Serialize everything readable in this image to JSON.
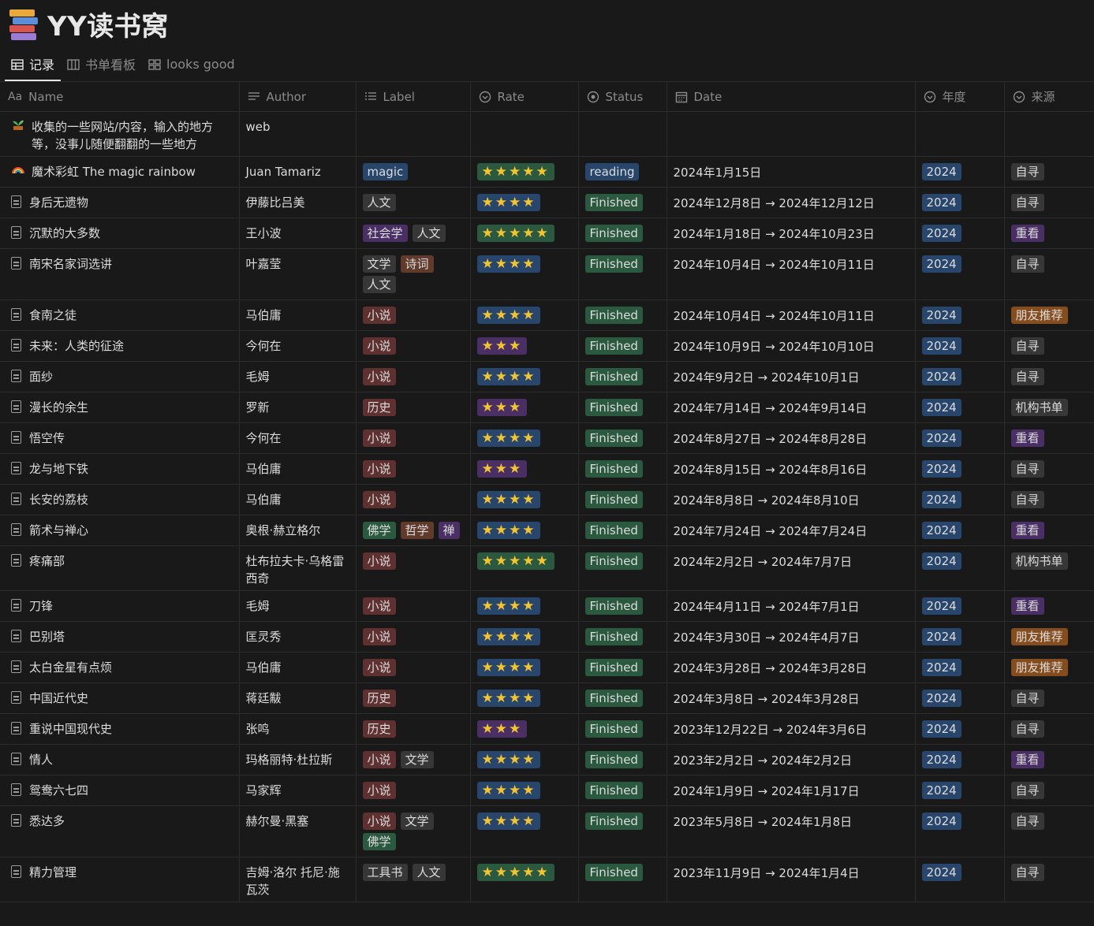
{
  "page": {
    "title": "YY读书窝",
    "tabs": [
      {
        "label": "记录",
        "icon": "table-icon",
        "active": true
      },
      {
        "label": "书单看板",
        "icon": "board-icon",
        "active": false
      },
      {
        "label": "looks good",
        "icon": "gallery-icon",
        "active": false
      }
    ]
  },
  "columns": [
    {
      "label": "Name",
      "prefix": "Aa",
      "icon": "title-icon"
    },
    {
      "label": "Author",
      "icon": "text-icon"
    },
    {
      "label": "Label",
      "icon": "multiselect-icon"
    },
    {
      "label": "Rate",
      "icon": "select-icon"
    },
    {
      "label": "Status",
      "icon": "status-icon"
    },
    {
      "label": "Date",
      "icon": "calendar-icon"
    },
    {
      "label": "年度",
      "icon": "select-icon"
    },
    {
      "label": "来源",
      "icon": "select-icon"
    }
  ],
  "colors": {
    "tag_default": "#373737",
    "tag_purple": "#492f64",
    "tag_red": "#5e3030",
    "tag_brown": "#603b2c",
    "tag_green": "#2b593f",
    "tag_blue": "#28456c",
    "tag_orange": "#854c1d",
    "stars_green": "#2b593f",
    "stars_blue": "#28456c",
    "stars_purple": "#492f64",
    "star": "#f4c430"
  },
  "rows": [
    {
      "icon": "plant-icon",
      "name": "收集的一些网站/内容，输入的地方等，没事儿随便翻翻的一些地方",
      "author": "web",
      "labels": [],
      "rate": "",
      "status": "",
      "date": "",
      "year": "",
      "source": ""
    },
    {
      "icon": "rainbow-icon",
      "name": "魔术彩虹 The magic rainbow",
      "author": "Juan Tamariz",
      "labels": [
        {
          "t": "magic",
          "c": "tag_blue"
        }
      ],
      "rate": "★★★★★",
      "rate_color": "stars_green",
      "status": "reading",
      "status_color": "tag_blue",
      "date": "2024年1月15日",
      "year": "2024",
      "source": "自寻",
      "source_color": "tag_default"
    },
    {
      "icon": "doc-icon",
      "name": "身后无遗物",
      "author": "伊藤比吕美",
      "labels": [
        {
          "t": "人文",
          "c": "tag_default"
        }
      ],
      "rate": "★★★★",
      "rate_color": "stars_blue",
      "status": "Finished",
      "status_color": "tag_green",
      "date": "2024年12月8日 → 2024年12月12日",
      "year": "2024",
      "source": "自寻",
      "source_color": "tag_default"
    },
    {
      "icon": "doc-icon",
      "name": "沉默的大多数",
      "author": "王小波",
      "labels": [
        {
          "t": "社会学",
          "c": "tag_purple"
        },
        {
          "t": "人文",
          "c": "tag_default"
        }
      ],
      "rate": "★★★★★",
      "rate_color": "stars_green",
      "status": "Finished",
      "status_color": "tag_green",
      "date": "2024年1月18日 → 2024年10月23日",
      "year": "2024",
      "source": "重看",
      "source_color": "tag_purple"
    },
    {
      "icon": "doc-icon",
      "name": "南宋名家词选讲",
      "author": "叶嘉莹",
      "labels": [
        {
          "t": "文学",
          "c": "tag_default"
        },
        {
          "t": "诗词",
          "c": "tag_brown"
        },
        {
          "t": "人文",
          "c": "tag_default"
        }
      ],
      "rate": "★★★★",
      "rate_color": "stars_blue",
      "status": "Finished",
      "status_color": "tag_green",
      "date": "2024年10月4日 → 2024年10月11日",
      "year": "2024",
      "source": "自寻",
      "source_color": "tag_default"
    },
    {
      "icon": "doc-icon",
      "name": "食南之徒",
      "author": "马伯庸",
      "labels": [
        {
          "t": "小说",
          "c": "tag_red"
        }
      ],
      "rate": "★★★★",
      "rate_color": "stars_blue",
      "status": "Finished",
      "status_color": "tag_green",
      "date": "2024年10月4日 → 2024年10月11日",
      "year": "2024",
      "source": "朋友推荐",
      "source_color": "tag_orange"
    },
    {
      "icon": "doc-icon",
      "name": "未来：人类的征途",
      "author": "今何在",
      "labels": [
        {
          "t": "小说",
          "c": "tag_red"
        }
      ],
      "rate": "★★★",
      "rate_color": "stars_purple",
      "status": "Finished",
      "status_color": "tag_green",
      "date": "2024年10月9日 → 2024年10月10日",
      "year": "2024",
      "source": "自寻",
      "source_color": "tag_default"
    },
    {
      "icon": "doc-icon",
      "name": "面纱",
      "author": "毛姆",
      "labels": [
        {
          "t": "小说",
          "c": "tag_red"
        }
      ],
      "rate": "★★★★",
      "rate_color": "stars_blue",
      "status": "Finished",
      "status_color": "tag_green",
      "date": "2024年9月2日 → 2024年10月1日",
      "year": "2024",
      "source": "自寻",
      "source_color": "tag_default"
    },
    {
      "icon": "doc-icon",
      "name": "漫长的余生",
      "author": "罗新",
      "labels": [
        {
          "t": "历史",
          "c": "tag_red"
        }
      ],
      "rate": "★★★",
      "rate_color": "stars_purple",
      "status": "Finished",
      "status_color": "tag_green",
      "date": "2024年7月14日 → 2024年9月14日",
      "year": "2024",
      "source": "机构书单",
      "source_color": "tag_default"
    },
    {
      "icon": "doc-icon",
      "name": "悟空传",
      "author": "今何在",
      "labels": [
        {
          "t": "小说",
          "c": "tag_red"
        }
      ],
      "rate": "★★★★",
      "rate_color": "stars_blue",
      "status": "Finished",
      "status_color": "tag_green",
      "date": "2024年8月27日 → 2024年8月28日",
      "year": "2024",
      "source": "重看",
      "source_color": "tag_purple"
    },
    {
      "icon": "doc-icon",
      "name": "龙与地下铁",
      "author": "马伯庸",
      "labels": [
        {
          "t": "小说",
          "c": "tag_red"
        }
      ],
      "rate": "★★★",
      "rate_color": "stars_purple",
      "status": "Finished",
      "status_color": "tag_green",
      "date": "2024年8月15日 → 2024年8月16日",
      "year": "2024",
      "source": "自寻",
      "source_color": "tag_default"
    },
    {
      "icon": "doc-icon",
      "name": "长安的荔枝",
      "author": "马伯庸",
      "labels": [
        {
          "t": "小说",
          "c": "tag_red"
        }
      ],
      "rate": "★★★★",
      "rate_color": "stars_blue",
      "status": "Finished",
      "status_color": "tag_green",
      "date": "2024年8月8日 → 2024年8月10日",
      "year": "2024",
      "source": "自寻",
      "source_color": "tag_default"
    },
    {
      "icon": "doc-icon",
      "name": "箭术与禅心",
      "author": "奥根·赫立格尔",
      "labels": [
        {
          "t": "佛学",
          "c": "tag_green"
        },
        {
          "t": "哲学",
          "c": "tag_brown"
        },
        {
          "t": "禅",
          "c": "tag_purple"
        }
      ],
      "rate": "★★★★",
      "rate_color": "stars_blue",
      "status": "Finished",
      "status_color": "tag_green",
      "date": "2024年7月24日 → 2024年7月24日",
      "year": "2024",
      "source": "重看",
      "source_color": "tag_purple"
    },
    {
      "icon": "doc-icon",
      "name": "疼痛部",
      "author": "杜布拉夫卡·乌格雷西奇",
      "labels": [
        {
          "t": "小说",
          "c": "tag_red"
        }
      ],
      "rate": "★★★★★",
      "rate_color": "stars_green",
      "status": "Finished",
      "status_color": "tag_green",
      "date": "2024年2月2日 → 2024年7月7日",
      "year": "2024",
      "source": "机构书单",
      "source_color": "tag_default"
    },
    {
      "icon": "doc-icon",
      "name": "刀锋",
      "author": "毛姆",
      "labels": [
        {
          "t": "小说",
          "c": "tag_red"
        }
      ],
      "rate": "★★★★",
      "rate_color": "stars_blue",
      "status": "Finished",
      "status_color": "tag_green",
      "date": "2024年4月11日 → 2024年7月1日",
      "year": "2024",
      "source": "重看",
      "source_color": "tag_purple"
    },
    {
      "icon": "doc-icon",
      "name": "巴别塔",
      "author": "匡灵秀",
      "labels": [
        {
          "t": "小说",
          "c": "tag_red"
        }
      ],
      "rate": "★★★★",
      "rate_color": "stars_blue",
      "status": "Finished",
      "status_color": "tag_green",
      "date": "2024年3月30日 → 2024年4月7日",
      "year": "2024",
      "source": "朋友推荐",
      "source_color": "tag_orange"
    },
    {
      "icon": "doc-icon",
      "name": "太白金星有点烦",
      "author": "马伯庸",
      "labels": [
        {
          "t": "小说",
          "c": "tag_red"
        }
      ],
      "rate": "★★★★",
      "rate_color": "stars_blue",
      "status": "Finished",
      "status_color": "tag_green",
      "date": "2024年3月28日 → 2024年3月28日",
      "year": "2024",
      "source": "朋友推荐",
      "source_color": "tag_orange"
    },
    {
      "icon": "doc-icon",
      "name": "中国近代史",
      "author": "蒋廷黻",
      "labels": [
        {
          "t": "历史",
          "c": "tag_red"
        }
      ],
      "rate": "★★★★",
      "rate_color": "stars_blue",
      "status": "Finished",
      "status_color": "tag_green",
      "date": "2024年3月8日 → 2024年3月28日",
      "year": "2024",
      "source": "自寻",
      "source_color": "tag_default"
    },
    {
      "icon": "doc-icon",
      "name": "重说中国现代史",
      "author": "张鸣",
      "labels": [
        {
          "t": "历史",
          "c": "tag_red"
        }
      ],
      "rate": "★★★",
      "rate_color": "stars_purple",
      "status": "Finished",
      "status_color": "tag_green",
      "date": "2023年12月22日 → 2024年3月6日",
      "year": "2024",
      "source": "自寻",
      "source_color": "tag_default"
    },
    {
      "icon": "doc-icon",
      "name": "情人",
      "author": "玛格丽特·杜拉斯",
      "labels": [
        {
          "t": "小说",
          "c": "tag_red"
        },
        {
          "t": "文学",
          "c": "tag_default"
        }
      ],
      "rate": "★★★★",
      "rate_color": "stars_blue",
      "status": "Finished",
      "status_color": "tag_green",
      "date": "2023年2月2日 → 2024年2月2日",
      "year": "2024",
      "source": "重看",
      "source_color": "tag_purple"
    },
    {
      "icon": "doc-icon",
      "name": "鸳鸯六七四",
      "author": "马家辉",
      "labels": [
        {
          "t": "小说",
          "c": "tag_red"
        }
      ],
      "rate": "★★★★",
      "rate_color": "stars_blue",
      "status": "Finished",
      "status_color": "tag_green",
      "date": "2024年1月9日 → 2024年1月17日",
      "year": "2024",
      "source": "自寻",
      "source_color": "tag_default"
    },
    {
      "icon": "doc-icon",
      "name": "悉达多",
      "author": "赫尔曼·黑塞",
      "labels": [
        {
          "t": "小说",
          "c": "tag_red"
        },
        {
          "t": "文学",
          "c": "tag_default"
        },
        {
          "t": "佛学",
          "c": "tag_green"
        }
      ],
      "rate": "★★★★",
      "rate_color": "stars_blue",
      "status": "Finished",
      "status_color": "tag_green",
      "date": "2023年5月8日 → 2024年1月8日",
      "year": "2024",
      "source": "自寻",
      "source_color": "tag_default"
    },
    {
      "icon": "doc-icon",
      "name": "精力管理",
      "author": "吉姆·洛尔 托尼·施瓦茨",
      "labels": [
        {
          "t": "工具书",
          "c": "tag_default"
        },
        {
          "t": "人文",
          "c": "tag_default"
        }
      ],
      "rate": "★★★★★",
      "rate_color": "stars_green",
      "status": "Finished",
      "status_color": "tag_green",
      "date": "2023年11月9日 → 2024年1月4日",
      "year": "2024",
      "source": "自寻",
      "source_color": "tag_default"
    }
  ]
}
